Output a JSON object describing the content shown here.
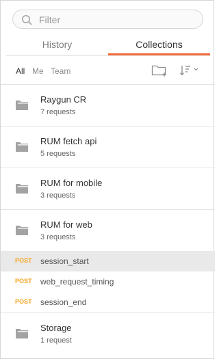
{
  "search": {
    "placeholder": "Filter",
    "value": ""
  },
  "tabs": [
    {
      "label": "History",
      "active": false
    },
    {
      "label": "Collections",
      "active": true
    }
  ],
  "filters": {
    "all": "All",
    "me": "Me",
    "team": "Team"
  },
  "toolbar": {
    "new_collection_icon": "new-folder-icon",
    "sort_icon": "sort-icon"
  },
  "collections": [
    {
      "name": "Raygun CR",
      "count": "7 requests"
    },
    {
      "name": "RUM fetch api",
      "count": "5 requests"
    },
    {
      "name": "RUM for mobile",
      "count": "3 requests"
    },
    {
      "name": "RUM for web",
      "count": "3 requests",
      "requests": [
        {
          "method": "POST",
          "name": "session_start",
          "selected": true
        },
        {
          "method": "POST",
          "name": "web_request_timing",
          "selected": false
        },
        {
          "method": "POST",
          "name": "session_end",
          "selected": false
        }
      ]
    },
    {
      "name": "Storage",
      "count": "1 request"
    }
  ],
  "colors": {
    "accent": "#f26b3a",
    "post": "#f5a623",
    "selected_row": "#e9e9e9"
  }
}
